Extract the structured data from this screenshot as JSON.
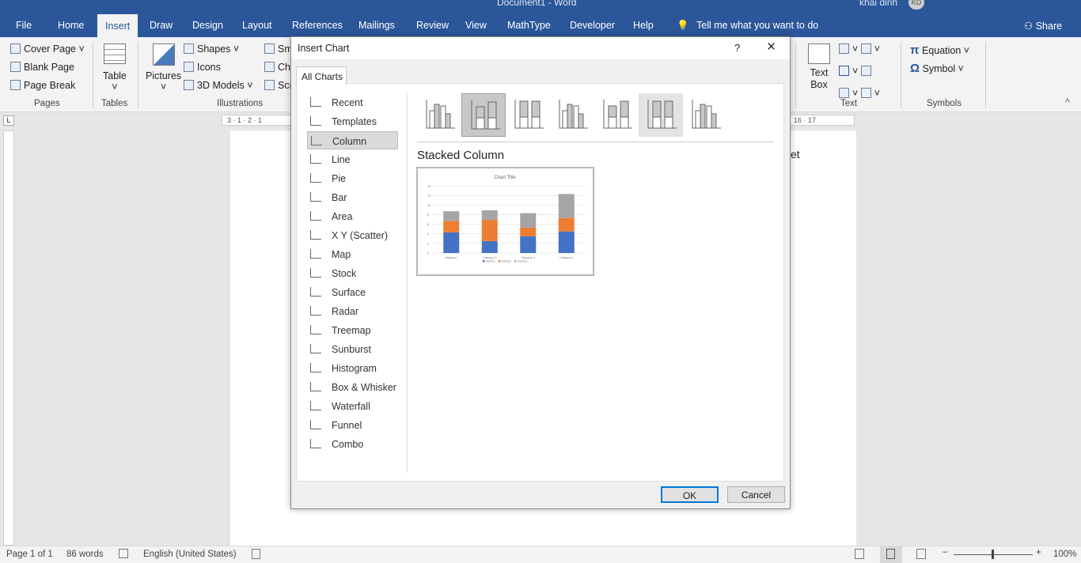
{
  "titlebar": {
    "title": "Document1 - Word",
    "user": "khai dinh",
    "avatar": "KD"
  },
  "tabs": [
    "File",
    "Home",
    "Insert",
    "Draw",
    "Design",
    "Layout",
    "References",
    "Mailings",
    "Review",
    "View",
    "MathType",
    "Developer",
    "Help"
  ],
  "active_tab": "Insert",
  "tellme": "Tell me what you want to do",
  "share": "Share",
  "ribbon": {
    "pages": [
      "Cover Page",
      "Blank Page",
      "Page Break"
    ],
    "pages_group": "Pages",
    "table": "Table",
    "tables_group": "Tables",
    "pictures": "Pictures",
    "shapes": "Shapes",
    "icons": "Icons",
    "models": "3D Models",
    "smartart": "Sm",
    "chart": "Ch",
    "screenshot": "Scr",
    "illustrations_group": "Illustrations",
    "textbox": "Text Box",
    "text_group": "Text",
    "equation": "Equation",
    "symbol": "Symbol",
    "symbols_group": "Symbols"
  },
  "ruler": {
    "left": "3 · 1 · 2 · 1",
    "right": "16 · 17"
  },
  "document": {
    "visible_text": "et"
  },
  "dialog": {
    "title": "Insert Chart",
    "help": "?",
    "close": "×",
    "tab": "All Charts",
    "categories": [
      "Recent",
      "Templates",
      "Column",
      "Line",
      "Pie",
      "Bar",
      "Area",
      "X Y (Scatter)",
      "Map",
      "Stock",
      "Surface",
      "Radar",
      "Treemap",
      "Sunburst",
      "Histogram",
      "Box & Whisker",
      "Waterfall",
      "Funnel",
      "Combo"
    ],
    "selected_category": "Column",
    "subtypes": [
      "Clustered Column",
      "Stacked Column",
      "100% Stacked Column",
      "3-D Clustered Column",
      "3-D Stacked Column",
      "3-D 100% Stacked Column",
      "3-D Column"
    ],
    "selected_subtype": "Stacked Column",
    "ok": "OK",
    "cancel": "Cancel"
  },
  "chart_data": {
    "type": "bar",
    "stacked": true,
    "title": "Chart Title",
    "categories": [
      "Category 1",
      "Category 2",
      "Category 3",
      "Category 4"
    ],
    "series": [
      {
        "name": "Series1",
        "values": [
          4.3,
          2.5,
          3.5,
          4.5
        ],
        "color": "#4472c4"
      },
      {
        "name": "Series2",
        "values": [
          2.4,
          4.4,
          1.8,
          2.8
        ],
        "color": "#ed7d31"
      },
      {
        "name": "Series3",
        "values": [
          2,
          2,
          3,
          5
        ],
        "color": "#a5a5a5"
      }
    ],
    "ylim": [
      0,
      14
    ],
    "yticks": [
      "0",
      "2",
      "4",
      "6",
      "8",
      "10",
      "12",
      "14"
    ],
    "grid": true,
    "legend": "bottom"
  },
  "status": {
    "page": "Page 1 of 1",
    "words": "86 words",
    "language": "English (United States)",
    "zoom": "100%"
  },
  "colors": {
    "word_blue": "#2b579a",
    "ok_border": "#0078d7"
  }
}
